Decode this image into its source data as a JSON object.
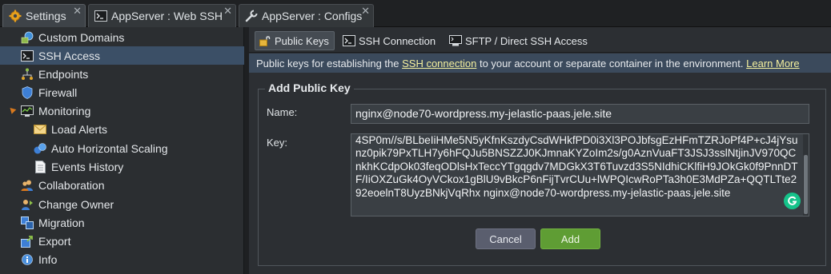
{
  "tabs": [
    {
      "label": "Settings",
      "icon": "gear-icon",
      "active": true
    },
    {
      "label": "AppServer : Web SSH",
      "icon": "terminal-icon",
      "active": false
    },
    {
      "label": "AppServer : Configs",
      "icon": "wrench-icon",
      "active": false
    }
  ],
  "sidebar": {
    "items": [
      {
        "label": "Custom Domains",
        "icon": "domains-icon"
      },
      {
        "label": "SSH Access",
        "icon": "terminal-icon",
        "selected": true
      },
      {
        "label": "Endpoints",
        "icon": "endpoints-icon"
      },
      {
        "label": "Firewall",
        "icon": "shield-icon"
      },
      {
        "label": "Monitoring",
        "icon": "monitoring-icon",
        "expanded": true
      },
      {
        "label": "Load Alerts",
        "icon": "envelope-icon"
      },
      {
        "label": "Auto Horizontal Scaling",
        "icon": "scaling-icon"
      },
      {
        "label": "Events History",
        "icon": "document-icon"
      },
      {
        "label": "Collaboration",
        "icon": "users-icon"
      },
      {
        "label": "Change Owner",
        "icon": "change-owner-icon"
      },
      {
        "label": "Migration",
        "icon": "migration-icon"
      },
      {
        "label": "Export",
        "icon": "export-icon"
      },
      {
        "label": "Info",
        "icon": "info-icon"
      }
    ]
  },
  "subtabs": [
    {
      "label": "Public Keys",
      "icon": "lock-icon",
      "active": true
    },
    {
      "label": "SSH Connection",
      "icon": "terminal-icon",
      "active": false
    },
    {
      "label": "SFTP / Direct SSH Access",
      "icon": "sftp-icon",
      "active": false
    }
  ],
  "info": {
    "prefix": "Public keys for establishing the ",
    "link1": "SSH connection",
    "middle": " to your account or separate container in the environment. ",
    "link2": "Learn More"
  },
  "form": {
    "legend": "Add Public Key",
    "name_label": "Name:",
    "name_value": "nginx@node70-wordpress.my-jelastic-paas.jele.site",
    "key_label": "Key:",
    "key_value": "4SP0m//s/BLbeIiHMe5N5yKfnKszdyCsdWHkfPD0i3Xl3POJbfsgEzHFmTZRJoPf4P+cJ4jYsunz0pik79PxTLH7y6hFQJu5BNSZZJ0KJmnaKYZoIm2s/g0AznVuaFT3JSJ3sslNtjinJV970QCnkhKCdpOk03feqODlsHxTeccYTgqgdv7MDGkX3T6Tuvzd3S5NIdhiCKlfiH9JOkGk0f9PnnDTF/IiOXZuGk4OyVCkox1gBlU9vBkcP6nFijTvrCUu+lWPQIcwRoPTa3h0E3MdPZa+QQTLTte292eoelnT8UyzBNkjVqRhx nginx@node70-wordpress.my-jelastic-paas.jele.site",
    "cancel_label": "Cancel",
    "add_label": "Add"
  },
  "colors": {
    "selected_item": "#3b4f66",
    "add_button": "#5f9d34",
    "cancel_button": "#5a5e6e",
    "link": "#f3ef9e",
    "grammarly_badge": "#15c38a"
  }
}
